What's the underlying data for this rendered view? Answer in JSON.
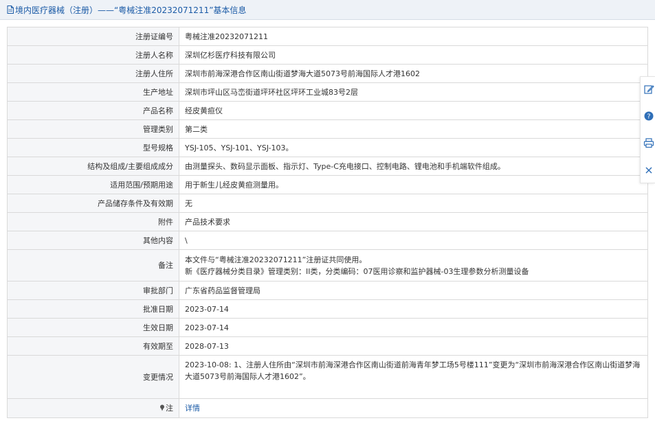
{
  "header": {
    "title": "境内医疗器械（注册）——“粤械注准20232071211”基本信息",
    "icon": "document-icon"
  },
  "rows": [
    {
      "label": "注册证编号",
      "lines": [
        "粤械注准20232071211"
      ]
    },
    {
      "label": "注册人名称",
      "lines": [
        "深圳亿杉医疗科技有限公司"
      ]
    },
    {
      "label": "注册人住所",
      "lines": [
        "深圳市前海深港合作区南山街道梦海大道5073号前海国际人才港1602"
      ]
    },
    {
      "label": "生产地址",
      "lines": [
        "深圳市坪山区马峦街道坪环社区坪环工业城83号2层"
      ]
    },
    {
      "label": "产品名称",
      "lines": [
        "经皮黄疸仪"
      ]
    },
    {
      "label": "管理类别",
      "lines": [
        "第二类"
      ]
    },
    {
      "label": "型号规格",
      "lines": [
        "YSJ-105、YSJ-101、YSJ-103。"
      ]
    },
    {
      "label": "结构及组成/主要组成成分",
      "lines": [
        "由测量探头、数码显示面板、指示灯、Type-C充电接口、控制电路、锂电池和手机端软件组成。"
      ]
    },
    {
      "label": "适用范围/预期用途",
      "lines": [
        "用于新生儿经皮黄疸测量用。"
      ]
    },
    {
      "label": "产品储存条件及有效期",
      "lines": [
        "无"
      ]
    },
    {
      "label": "附件",
      "lines": [
        "产品技术要求"
      ]
    },
    {
      "label": "其他内容",
      "lines": [
        "\\"
      ]
    },
    {
      "label": "备注",
      "lines": [
        "本文件与“粤械注准20232071211”注册证共同使用。",
        "新《医疗器械分类目录》管理类别：II类，分类编码：07医用诊察和监护器械-03生理参数分析测量设备"
      ]
    },
    {
      "label": "审批部门",
      "lines": [
        "广东省药品监督管理局"
      ]
    },
    {
      "label": "批准日期",
      "lines": [
        "2023-07-14"
      ]
    },
    {
      "label": "生效日期",
      "lines": [
        "2023-07-14"
      ]
    },
    {
      "label": "有效期至",
      "lines": [
        "2028-07-13"
      ]
    },
    {
      "label": "变更情况",
      "lines": [
        "2023-10-08: 1、注册人住所由“深圳市前海深港合作区南山街道前海青年梦工场5号楼111”变更为“深圳市前海深港合作区南山街道梦海大道5073号前海国际人才港1602”。"
      ]
    }
  ],
  "note_row": {
    "label": "注",
    "value": "详情",
    "icon": "pin-icon"
  },
  "sidebar": {
    "buttons": [
      {
        "name": "edit-icon"
      },
      {
        "name": "help-icon"
      },
      {
        "name": "print-icon"
      },
      {
        "name": "close-icon"
      }
    ]
  },
  "colors": {
    "accent": "#1a5aa6",
    "header_bg": "#eef2f7",
    "label_bg": "#f5f6f8",
    "border": "#d9d9d9"
  }
}
